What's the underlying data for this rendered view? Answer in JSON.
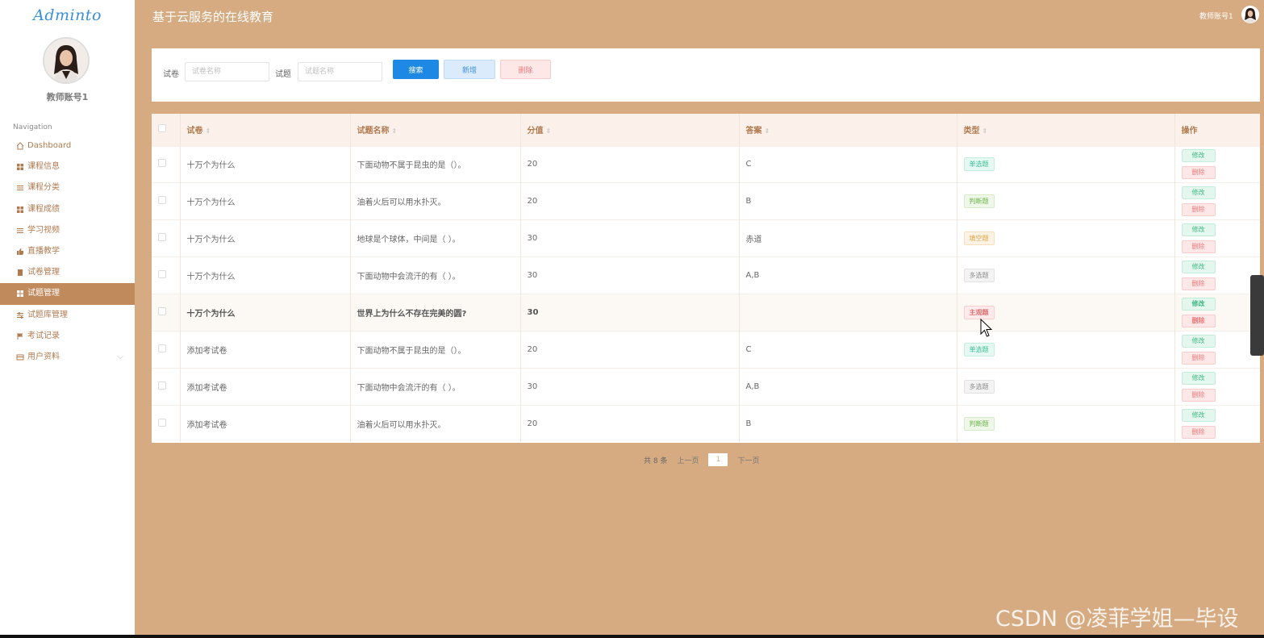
{
  "sidebar": {
    "logo": "Adminto",
    "user_name": "教师账号1",
    "nav_title": "Navigation",
    "items": [
      {
        "label": "Dashboard",
        "icon": "home-icon"
      },
      {
        "label": "课程信息",
        "icon": "grid-icon"
      },
      {
        "label": "课程分类",
        "icon": "list-icon"
      },
      {
        "label": "课程成绩",
        "icon": "grid-icon"
      },
      {
        "label": "学习视频",
        "icon": "list-icon"
      },
      {
        "label": "直播教学",
        "icon": "thumb-icon"
      },
      {
        "label": "试卷管理",
        "icon": "doc-icon"
      },
      {
        "label": "试题管理",
        "icon": "grid-icon"
      },
      {
        "label": "试题库管理",
        "icon": "sliders-icon"
      },
      {
        "label": "考试记录",
        "icon": "flag-icon"
      },
      {
        "label": "用户资料",
        "icon": "card-icon"
      }
    ]
  },
  "header": {
    "title": "基于云服务的在线教育",
    "user": "教师账号1"
  },
  "search": {
    "paper_label": "试卷",
    "paper_placeholder": "试卷名称",
    "question_label": "试题",
    "question_placeholder": "试题名称",
    "search_btn": "搜索",
    "add_btn": "新增",
    "delete_btn": "删除"
  },
  "table": {
    "columns": [
      "试卷",
      "试题名称",
      "分值",
      "答案",
      "类型",
      "操作"
    ],
    "edit_label": "修改",
    "delete_label": "删除",
    "rows": [
      {
        "paper": "十万个为什么",
        "question": "下面动物不属于昆虫的是（）。",
        "score": "20",
        "answer": "C",
        "type": "单选题"
      },
      {
        "paper": "十万个为什么",
        "question": "油着火后可以用水扑灭。",
        "score": "20",
        "answer": "B",
        "type": "判断题"
      },
      {
        "paper": "十万个为什么",
        "question": "地球是个球体，中间是（ ）。",
        "score": "30",
        "answer": "赤道",
        "type": "填空题"
      },
      {
        "paper": "十万个为什么",
        "question": "下面动物中会流汗的有（ ）。",
        "score": "30",
        "answer": "A,B",
        "type": "多选题"
      },
      {
        "paper": "十万个为什么",
        "question": "世界上为什么不存在完美的圆?",
        "score": "30",
        "answer": "",
        "type": "主观题"
      },
      {
        "paper": "添加考试卷",
        "question": "下面动物不属于昆虫的是（）。",
        "score": "20",
        "answer": "C",
        "type": "单选题"
      },
      {
        "paper": "添加考试卷",
        "question": "下面动物中会流汗的有（ ）。",
        "score": "30",
        "answer": "A,B",
        "type": "多选题"
      },
      {
        "paper": "添加考试卷",
        "question": "油着火后可以用水扑灭。",
        "score": "20",
        "answer": "B",
        "type": "判断题"
      }
    ]
  },
  "pagination": {
    "total": "共 8 条",
    "prev": "上一页",
    "current": "1",
    "next": "下一页"
  },
  "watermark": "CSDN @凌菲学姐—毕设",
  "colors": {
    "background": "#d6ab82",
    "sidebar_active": "#c08a5c",
    "primary": "#1e88e5"
  }
}
